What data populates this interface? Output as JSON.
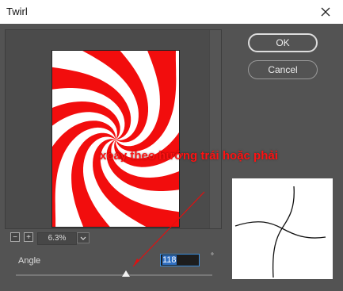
{
  "window": {
    "title": "Twirl"
  },
  "buttons": {
    "ok": "OK",
    "cancel": "Cancel"
  },
  "zoom": {
    "minus": "−",
    "plus": "+",
    "value": "6.3%"
  },
  "angle": {
    "label": "Angle",
    "value": "118",
    "unit": "°",
    "slider_fraction": 0.56
  },
  "annotation": {
    "text": "xoay theo hướng trái hoặc phải",
    "color": "#ff1212"
  },
  "colors": {
    "swirl_red": "#f20d0d",
    "swirl_white": "#ffffff",
    "dialog_bg": "#535353"
  },
  "icons": {
    "close": "close-icon",
    "dropdown": "chevron-down-icon"
  }
}
